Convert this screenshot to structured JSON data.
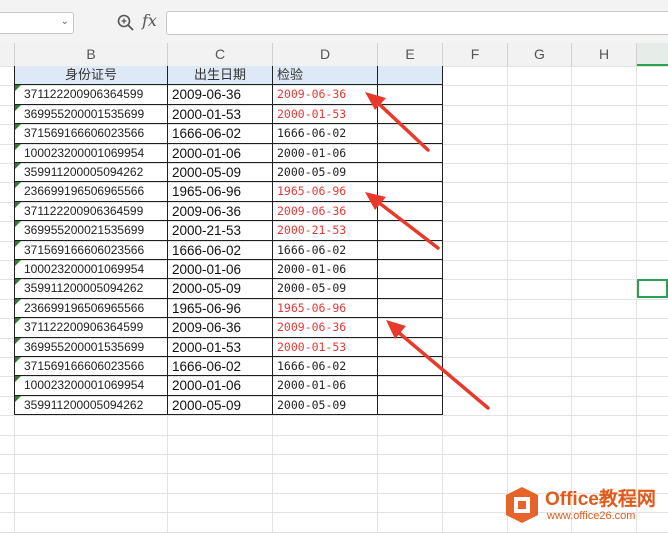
{
  "toolbar": {
    "name_box_value": "",
    "fx_label": "fx",
    "formula_value": ""
  },
  "columns": [
    "B",
    "C",
    "D",
    "E",
    "F",
    "G",
    "H"
  ],
  "table": {
    "headers": [
      "身份证号",
      "出生日期",
      "检验"
    ],
    "rows": [
      {
        "id": "371122200906364599",
        "date": "2009-06-36",
        "check": "2009-06-36",
        "invalid": true
      },
      {
        "id": "369955200001535699",
        "date": "2000-01-53",
        "check": "2000-01-53",
        "invalid": true
      },
      {
        "id": "371569166606023566",
        "date": "1666-06-02",
        "check": "1666-06-02",
        "invalid": false
      },
      {
        "id": "100023200001069954",
        "date": "2000-01-06",
        "check": "2000-01-06",
        "invalid": false
      },
      {
        "id": "359911200005094262",
        "date": "2000-05-09",
        "check": "2000-05-09",
        "invalid": false
      },
      {
        "id": "236699196506965566",
        "date": "1965-06-96",
        "check": "1965-06-96",
        "invalid": true
      },
      {
        "id": "371122200906364599",
        "date": "2009-06-36",
        "check": "2009-06-36",
        "invalid": true
      },
      {
        "id": "369955200021535699",
        "date": "2000-21-53",
        "check": "2000-21-53",
        "invalid": true
      },
      {
        "id": "371569166606023566",
        "date": "1666-06-02",
        "check": "1666-06-02",
        "invalid": false
      },
      {
        "id": "100023200001069954",
        "date": "2000-01-06",
        "check": "2000-01-06",
        "invalid": false
      },
      {
        "id": "359911200005094262",
        "date": "2000-05-09",
        "check": "2000-05-09",
        "invalid": false
      },
      {
        "id": "236699196506965566",
        "date": "1965-06-96",
        "check": "1965-06-96",
        "invalid": true
      },
      {
        "id": "371122200906364599",
        "date": "2009-06-36",
        "check": "2009-06-36",
        "invalid": true
      },
      {
        "id": "369955200001535699",
        "date": "2000-01-53",
        "check": "2000-01-53",
        "invalid": true
      },
      {
        "id": "371569166606023566",
        "date": "1666-06-02",
        "check": "1666-06-02",
        "invalid": false
      },
      {
        "id": "100023200001069954",
        "date": "2000-01-06",
        "check": "2000-01-06",
        "invalid": false
      },
      {
        "id": "359911200005094262",
        "date": "2000-05-09",
        "check": "2000-05-09",
        "invalid": false
      }
    ]
  },
  "colors": {
    "invalid_text": "#e53935",
    "valid_text": "#222222",
    "header_fill": "#dde9f6",
    "arrow": "#e8392c",
    "selection": "#2e9e4f"
  },
  "watermark": {
    "title": "Office教程网",
    "url": "www.office26.com"
  }
}
